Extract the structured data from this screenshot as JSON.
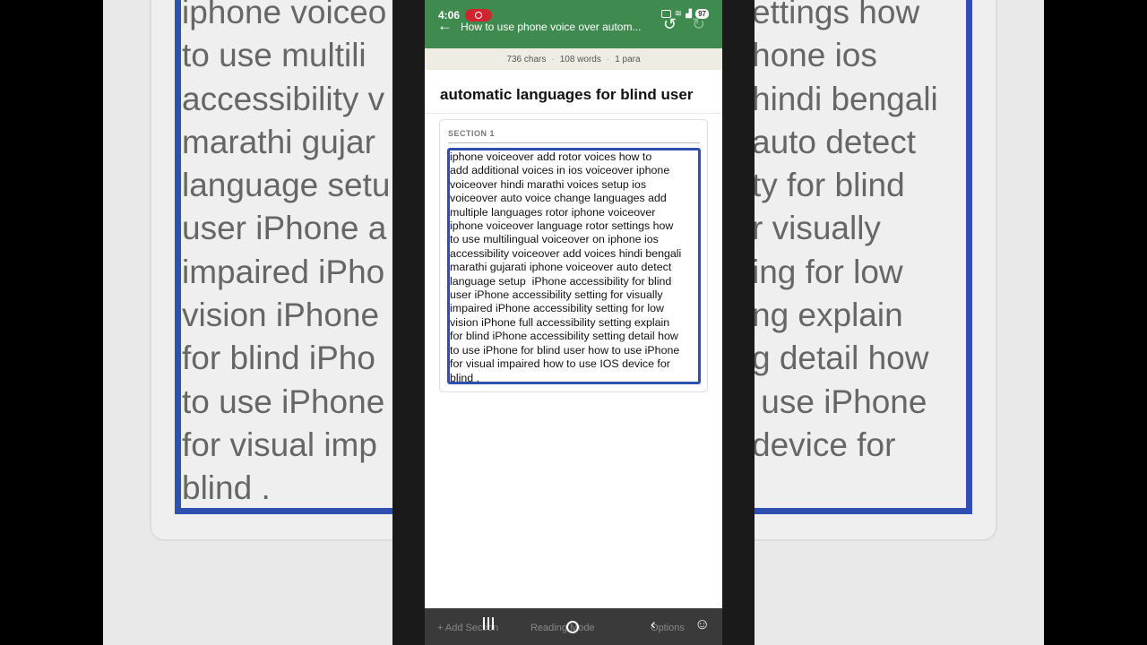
{
  "status_bar": {
    "time": "4:06",
    "battery": "97"
  },
  "app_bar": {
    "back_icon": "arrow-left-icon",
    "title": "How to use phone voice over autom...",
    "undo_icon": "undo-icon",
    "redo_icon": "redo-icon"
  },
  "stats": {
    "chars": "736 chars",
    "words": "108 words",
    "paras": "1 para"
  },
  "document": {
    "title": "automatic languages for blind user",
    "section_label": "SECTION 1",
    "body_lines": [
      "iphone voiceover add rotor voices how to",
      "add additional voices in ios voiceover iphone",
      "voiceover hindi marathi voices setup ios",
      "voiceover auto voice change languages add",
      "multiple languages rotor iphone voiceover",
      "iphone voiceover language rotor settings how",
      "to use multilingual voiceover on iphone ios",
      "accessibility voiceover add voices hindi bengali",
      "marathi gujarati iphone voiceover auto detect",
      "language setup  iPhone accessibility for blind",
      "user iPhone accessibility setting for visually",
      "impaired iPhone accessibility setting for low",
      "vision iPhone full accessibility setting explain",
      "for blind iPhone accessibility setting detail how",
      "to use iPhone for blind user how to use iPhone",
      "for visual impaired how to use IOS device for",
      "blind ."
    ]
  },
  "background_text": {
    "left_lines": [
      "iphone voiceo",
      "to use multili",
      "accessibility v",
      "marathi gujar",
      "language setu",
      "user iPhone a",
      "impaired iPho",
      "vision iPhone",
      "for blind iPho",
      "to use iPhone",
      "for visual imp",
      "blind ."
    ],
    "right_lines": [
      "ettings how",
      "hone ios",
      "hindi bengali",
      "auto detect",
      "ty for blind",
      "r visually",
      "ing for low",
      "ng explain",
      "g detail how",
      " use iPhone",
      "device for",
      ""
    ]
  },
  "bottom_bar": {
    "add_section": "+ Add Section",
    "reading_mode": "Reading Mode",
    "options": "Options"
  },
  "nav_icons": [
    "recents-icon",
    "home-icon",
    "back-icon",
    "accessibility-icon"
  ],
  "colors": {
    "app_bar": "#3f8a4f",
    "text_box_border": "#2f50b0",
    "stats_bg": "#efece4"
  }
}
